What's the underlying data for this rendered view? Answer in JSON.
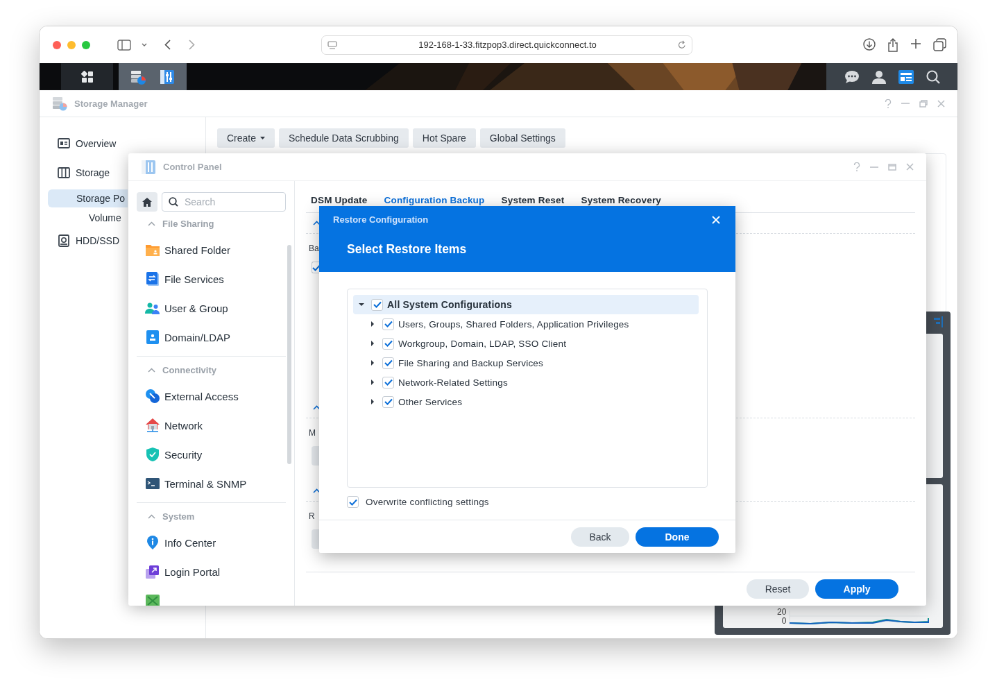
{
  "browser": {
    "url": "192-168-1-33.fitzpop3.direct.quickconnect.to"
  },
  "storage_manager": {
    "title": "Storage Manager",
    "sidebar": [
      {
        "label": "Overview",
        "kind": "overview",
        "selected": false
      },
      {
        "label": "Storage",
        "kind": "storage",
        "selected": false,
        "children": [
          {
            "label": "Storage Po",
            "selected": true,
            "children": [
              {
                "label": "Volume",
                "selected": false
              }
            ]
          }
        ]
      },
      {
        "label": "HDD/SSD",
        "kind": "hdd",
        "selected": false
      }
    ],
    "toolbar": [
      {
        "label": "Create",
        "dropdown": true
      },
      {
        "label": "Schedule Data Scrubbing",
        "dropdown": false
      },
      {
        "label": "Hot Spare",
        "dropdown": false
      },
      {
        "label": "Global Settings",
        "dropdown": false
      }
    ]
  },
  "widget": {
    "axis_labels": [
      "20",
      "0"
    ]
  },
  "control_panel": {
    "title": "Control Panel",
    "search": {
      "placeholder": "Search"
    },
    "groups": [
      {
        "title": "File Sharing",
        "expanded": true,
        "items": [
          {
            "label": "Shared Folder",
            "kind": "folder"
          },
          {
            "label": "File Services",
            "kind": "services"
          },
          {
            "label": "User & Group",
            "kind": "users"
          },
          {
            "label": "Domain/LDAP",
            "kind": "domain"
          }
        ]
      },
      {
        "title": "Connectivity",
        "expanded": true,
        "items": [
          {
            "label": "External Access",
            "kind": "external"
          },
          {
            "label": "Network",
            "kind": "network"
          },
          {
            "label": "Security",
            "kind": "security"
          },
          {
            "label": "Terminal & SNMP",
            "kind": "terminal"
          }
        ]
      },
      {
        "title": "System",
        "expanded": true,
        "items": [
          {
            "label": "Info Center",
            "kind": "info"
          },
          {
            "label": "Login Portal",
            "kind": "login"
          },
          {
            "kind": "regional"
          }
        ]
      }
    ],
    "tabs": [
      {
        "label": "DSM Update",
        "selected": false
      },
      {
        "label": "Configuration Backup",
        "selected": true
      },
      {
        "label": "System Reset",
        "selected": false
      },
      {
        "label": "System Recovery",
        "selected": false
      }
    ],
    "sections": [
      {
        "label": "Ba",
        "expanded": true,
        "kind": "checkbox",
        "checked": true
      },
      {
        "label": "M",
        "expanded": true,
        "kind": "button"
      },
      {
        "label": "R",
        "expanded": true,
        "kind": "button"
      }
    ],
    "buttons": [
      {
        "label": "Reset",
        "kind": "secondary"
      },
      {
        "label": "Apply",
        "kind": "primary"
      }
    ]
  },
  "dialog": {
    "title": "Restore Configuration",
    "heading": "Select Restore Items",
    "tree": {
      "label": "All System Configurations",
      "checked": true,
      "expanded": true,
      "children": [
        {
          "label": "Users, Groups, Shared Folders, Application Privileges",
          "checked": true,
          "expanded": false
        },
        {
          "label": "Workgroup, Domain, LDAP, SSO Client",
          "checked": true,
          "expanded": false
        },
        {
          "label": "File Sharing and Backup Services",
          "checked": true,
          "expanded": false
        },
        {
          "label": "Network-Related Settings",
          "checked": true,
          "expanded": false
        },
        {
          "label": "Other Services",
          "checked": true,
          "expanded": false
        }
      ]
    },
    "overwrite": {
      "label": "Overwrite conflicting settings",
      "checked": true
    },
    "buttons": [
      {
        "label": "Back",
        "kind": "secondary"
      },
      {
        "label": "Done",
        "kind": "primary"
      }
    ]
  }
}
